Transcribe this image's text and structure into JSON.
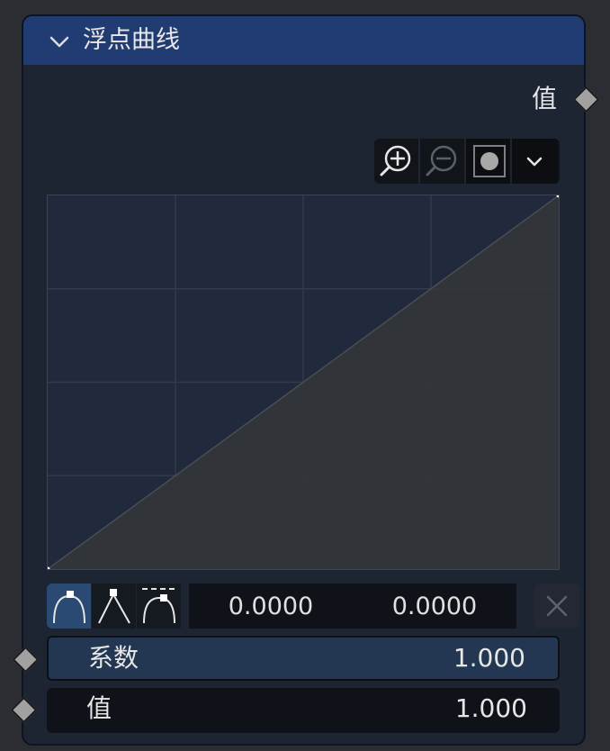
{
  "node": {
    "title": "浮点曲线",
    "output_label": "值"
  },
  "toolbar": {
    "buttons": [
      "zoom-in-icon",
      "zoom-out-icon",
      "clipping-icon",
      "chevron-down-icon"
    ]
  },
  "curve": {
    "points": [
      [
        0.0,
        0.0
      ],
      [
        1.0,
        1.0
      ]
    ],
    "grid_divisions": 4
  },
  "point_editor": {
    "handle_types": [
      "auto-handle-icon",
      "vector-handle-icon",
      "auto-clamped-handle-icon"
    ],
    "active_handle": 0,
    "x_value": "0.0000",
    "y_value": "0.0000"
  },
  "inputs": {
    "factor_label": "系数",
    "factor_value": "1.000",
    "value_label": "值",
    "value_value": "1.000"
  },
  "colors": {
    "header": "#213b73",
    "body": "#1d2533",
    "socket": "#a1a1a1",
    "curve_fill": "#333538"
  }
}
